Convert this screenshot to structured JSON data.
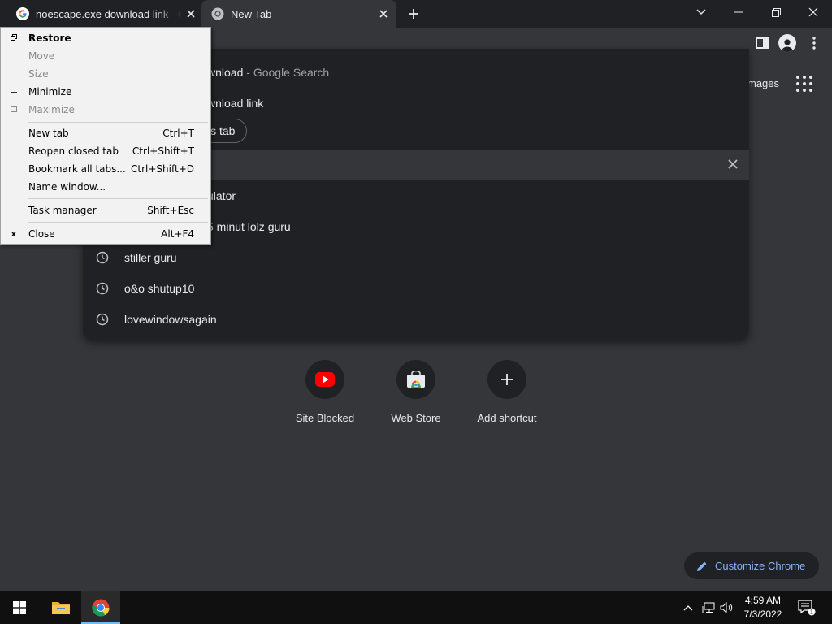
{
  "tabs": [
    {
      "title": "noescape.exe download link - Google Search",
      "favicon": "google-g-icon",
      "active": false
    },
    {
      "title": "New Tab",
      "favicon": "chrome-icon",
      "active": true
    }
  ],
  "omnibox_suggestions": [
    {
      "text": "wnload",
      "subtext": " - Google Search",
      "icon": "search-icon"
    },
    {
      "text": "wnload link",
      "icon": "search-icon"
    },
    {
      "text": "is tab",
      "icon": "tab-icon"
    },
    {
      "text": "",
      "icon": "history-icon"
    },
    {
      "text": "ulator",
      "icon": "history-icon"
    },
    {
      "text": "5 minut lolz guru",
      "icon": "history-icon"
    },
    {
      "text": "stiller guru",
      "icon": "history-icon"
    },
    {
      "text": "o&o shutup10",
      "icon": "history-icon"
    },
    {
      "text": "lovewindowsagain",
      "icon": "history-icon"
    }
  ],
  "ntp": {
    "images_link": "mages",
    "shortcuts": [
      {
        "label": "Site Blocked",
        "icon": "youtube-icon"
      },
      {
        "label": "Web Store",
        "icon": "web-store-icon"
      },
      {
        "label": "Add shortcut",
        "icon": "plus-icon"
      }
    ],
    "customize_label": "Customize Chrome"
  },
  "system_menu": {
    "items": [
      {
        "label": "Restore",
        "glyph": "restore-glyph",
        "key": "",
        "disabled": false,
        "bold": true
      },
      {
        "label": "Move",
        "glyph": "",
        "key": "",
        "disabled": true
      },
      {
        "label": "Size",
        "glyph": "",
        "key": "",
        "disabled": true
      },
      {
        "label": "Minimize",
        "glyph": "minimize-glyph",
        "key": "",
        "disabled": false
      },
      {
        "label": "Maximize",
        "glyph": "maximize-glyph",
        "key": "",
        "disabled": true
      },
      {
        "label": "New tab",
        "key": "Ctrl+T"
      },
      {
        "label": "Reopen closed tab",
        "key": "Ctrl+Shift+T"
      },
      {
        "label": "Bookmark all tabs...",
        "key": "Ctrl+Shift+D"
      },
      {
        "label": "Name window...",
        "key": ""
      },
      {
        "label": "Task manager",
        "key": "Shift+Esc"
      },
      {
        "label": "Close",
        "glyph": "x",
        "key": "Alt+F4"
      }
    ]
  },
  "taskbar": {
    "time": "4:59 AM",
    "date": "7/3/2022",
    "notification_count": "1"
  },
  "colors": {
    "tabstrip": "#202124",
    "toolbar": "#35363a",
    "accent_link": "#8ab4f8",
    "taskbar": "#101010"
  }
}
